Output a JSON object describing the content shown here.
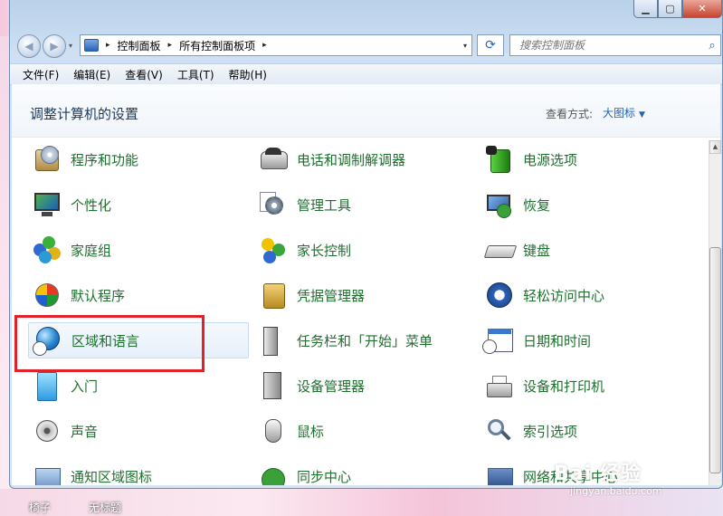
{
  "window": {
    "minimize_glyph": "▁",
    "maximize_glyph": "▢",
    "close_glyph": "✕"
  },
  "address_bar": {
    "breadcrumb": [
      "控制面板",
      "所有控制面板项"
    ],
    "separator": "▸",
    "dropdown_glyph": "▾",
    "refresh_glyph": "⟳"
  },
  "search": {
    "placeholder": "搜索控制面板",
    "icon_glyph": "⌕"
  },
  "nav": {
    "back_glyph": "◀",
    "forward_glyph": "▶"
  },
  "menu": [
    "文件(F)",
    "编辑(E)",
    "查看(V)",
    "工具(T)",
    "帮助(H)"
  ],
  "header": {
    "title": "调整计算机的设置",
    "view_label": "查看方式:",
    "view_value": "大图标",
    "view_arrow": "▼"
  },
  "items": {
    "col1": [
      "程序和功能",
      "个性化",
      "家庭组",
      "默认程序",
      "区域和语言",
      "入门",
      "声音",
      "通知区域图标"
    ],
    "col2": [
      "电话和调制解调器",
      "管理工具",
      "家长控制",
      "凭据管理器",
      "任务栏和「开始」菜单",
      "设备管理器",
      "鼠标",
      "同步中心"
    ],
    "col3": [
      "电源选项",
      "恢复",
      "键盘",
      "轻松访问中心",
      "日期和时间",
      "设备和打印机",
      "索引选项",
      "网络和共享中心"
    ]
  },
  "desktop": {
    "icon_labels": [
      "椅子",
      "无标题"
    ],
    "watermark": "Bai 经验",
    "watermark_url": "jingyan.baidu.com"
  },
  "colors": {
    "item_text": "#1f6f2f",
    "title_text": "#1e395b",
    "link_blue": "#2363b8",
    "highlight_red": "#e0222a"
  }
}
